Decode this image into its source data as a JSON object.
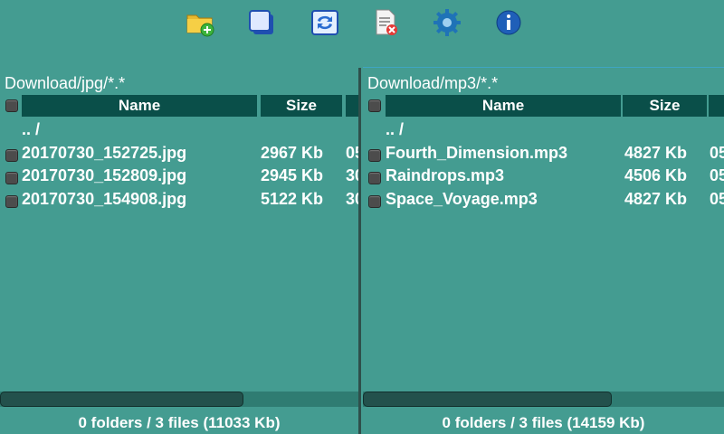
{
  "toolbar": {
    "buttons": [
      {
        "icon": "new-folder-icon"
      },
      {
        "icon": "select-all-icon"
      },
      {
        "icon": "swap-panels-icon"
      },
      {
        "icon": "delete-file-icon"
      },
      {
        "icon": "settings-gear-icon"
      },
      {
        "icon": "info-icon"
      }
    ]
  },
  "left": {
    "path": "Download/jpg/*.*",
    "columns": {
      "name": "Name",
      "size": "Size"
    },
    "parent": ".. /",
    "files": [
      {
        "name": "20170730_152725.jpg",
        "size": "2967 Kb",
        "extra": "05"
      },
      {
        "name": "20170730_152809.jpg",
        "size": "2945 Kb",
        "extra": "30"
      },
      {
        "name": "20170730_154908.jpg",
        "size": "5122 Kb",
        "extra": "30"
      }
    ],
    "status": "0 folders / 3 files (11033 Kb)",
    "scroll_fraction": 0.68
  },
  "right": {
    "path": "Download/mp3/*.*",
    "columns": {
      "name": "Name",
      "size": "Size"
    },
    "parent": ".. /",
    "files": [
      {
        "name": "Fourth_Dimension.mp3",
        "size": "4827 Kb",
        "extra": "05"
      },
      {
        "name": "Raindrops.mp3",
        "size": "4506 Kb",
        "extra": "05"
      },
      {
        "name": "Space_Voyage.mp3",
        "size": "4827 Kb",
        "extra": "05"
      }
    ],
    "status": "0 folders / 3 files (14159 Kb)",
    "scroll_fraction": 0.69
  },
  "colors": {
    "background": "#449c91",
    "header": "#0a4f49",
    "accent": "#3fa6c3"
  }
}
